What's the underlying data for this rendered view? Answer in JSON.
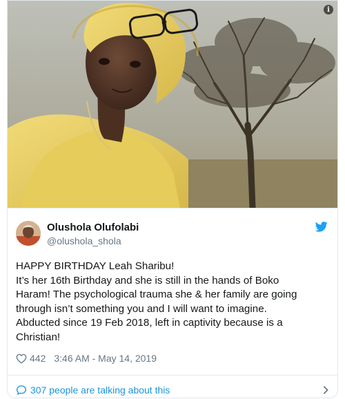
{
  "tweet": {
    "author": {
      "display_name": "Olushola Olufolabi",
      "handle": "@olushola_shola"
    },
    "text_lines": [
      "HAPPY BIRTHDAY Leah Sharibu!",
      "It’s her 16th Birthday and she is still in the hands of Boko",
      "Haram! The psychological trauma she & her family are going",
      "through isn’t something you and I will want to imagine.",
      "Abducted since 19 Feb 2018, left in captivity because is a",
      "Christian!"
    ],
    "like_count": "442",
    "timestamp": "3:46 AM - May 14, 2019",
    "conversation_label": "307 people are talking about this"
  },
  "media": {
    "info_glyph": "i"
  },
  "colors": {
    "link_blue": "#1b95e0",
    "muted": "#657786",
    "text": "#14171a",
    "border": "#e1e8ed"
  },
  "icons": [
    "info-icon",
    "twitter-bird-icon",
    "heart-icon",
    "speech-bubble-icon",
    "chevron-right-icon"
  ]
}
